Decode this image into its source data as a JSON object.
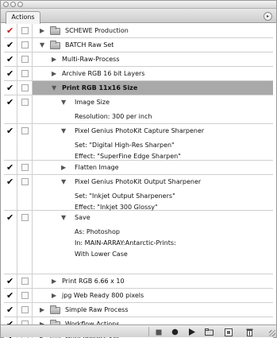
{
  "panel": {
    "tab_label": "Actions",
    "menu_icon": "flyout-menu-icon"
  },
  "rows": [
    {
      "label": "SCHEWE Production",
      "checked": true,
      "red_check": true,
      "type": "set",
      "expanded": false
    },
    {
      "label": "BATCH Raw Set",
      "checked": true,
      "red_check": false,
      "type": "set",
      "expanded": true
    },
    {
      "label": "Multi-Raw-Process",
      "checked": true,
      "type": "action",
      "expanded": false
    },
    {
      "label": "Archive RGB 16 bit Layers",
      "checked": true,
      "type": "action",
      "expanded": false
    },
    {
      "label": "Print RGB 11x16 Size",
      "checked": true,
      "type": "action",
      "expanded": true,
      "selected": true
    },
    {
      "label": "Image Size",
      "checked": true,
      "type": "step",
      "expanded": true,
      "details": [
        "Resolution: 300 per inch"
      ]
    },
    {
      "label": "Pixel Genius PhotoKit Capture Sharpener",
      "checked": true,
      "type": "step",
      "expanded": true,
      "details": [
        "Set:  \"Digital High-Res Sharpen\"",
        "Effect:  \"SuperFine Edge Sharpen\""
      ]
    },
    {
      "label": "Flatten Image",
      "checked": true,
      "type": "step",
      "expanded": false
    },
    {
      "label": "Pixel Genius PhotoKit Output Sharpener",
      "checked": true,
      "type": "step",
      "expanded": true,
      "details": [
        "Set:  \"Inkjet Output Sharpeners\"",
        "Effect:  \"Inkjet 300 Glossy\""
      ]
    },
    {
      "label": "Save",
      "checked": true,
      "type": "step",
      "expanded": true,
      "details": [
        "As: Photoshop",
        "In: MAIN-ARRAY:Antarctic-Prints:",
        "With Lower Case"
      ]
    },
    {
      "label": "Print RGB 6.66 x 10",
      "checked": true,
      "type": "action",
      "expanded": false
    },
    {
      "label": "jpg Web Ready 800 pixels",
      "checked": true,
      "type": "action",
      "expanded": false
    },
    {
      "label": "Simple Raw Process",
      "checked": true,
      "type": "set",
      "expanded": false
    },
    {
      "label": "Workflow Actions",
      "checked": true,
      "type": "set",
      "expanded": false
    },
    {
      "label": "Mutli-Process Set",
      "checked": true,
      "type": "set",
      "expanded": false
    }
  ],
  "toolbar": {
    "buttons": [
      {
        "name": "stop-button",
        "icon": "stop-icon"
      },
      {
        "name": "record-button",
        "icon": "record-icon"
      },
      {
        "name": "play-button",
        "icon": "play-icon"
      },
      {
        "name": "new-set-button",
        "icon": "folder-icon"
      },
      {
        "name": "new-action-button",
        "icon": "new-item-icon"
      },
      {
        "name": "delete-button",
        "icon": "trash-icon"
      }
    ]
  }
}
